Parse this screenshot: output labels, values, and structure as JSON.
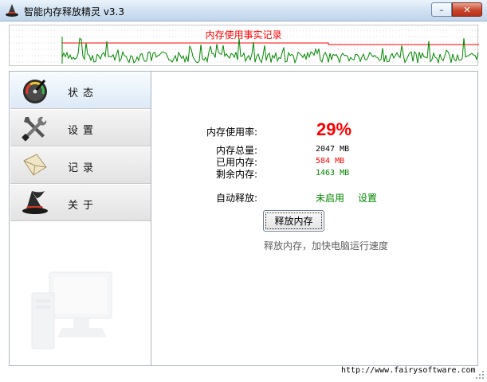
{
  "window": {
    "title": "智能内存释放精灵 v3.3",
    "minimize_label": "–",
    "close_label": "✕",
    "icon": "wizard-hat-icon"
  },
  "graph": {
    "title": "内存使用事实记录",
    "line_color": "#ff0000",
    "trace_color": "#008800"
  },
  "sidebar": {
    "items": [
      {
        "label": "状态",
        "icon": "speedometer-icon",
        "active": true
      },
      {
        "label": "设置",
        "icon": "tools-icon",
        "active": false
      },
      {
        "label": "记录",
        "icon": "envelope-icon",
        "active": false
      },
      {
        "label": "关于",
        "icon": "wizard-hat-icon",
        "active": false
      }
    ]
  },
  "status": {
    "usage_label": "内存使用率:",
    "usage_value": "29%",
    "total_label": "内存总量:",
    "total_value": "2047 MB",
    "used_label": "已用内存:",
    "used_value": "584 MB",
    "free_label": "剩余内存:",
    "free_value": "1463 MB",
    "auto_label": "自动释放:",
    "auto_value": "未启用",
    "settings_link": "设置",
    "release_button": "释放内存",
    "hint": "释放内存，加快电脑运行速度"
  },
  "footer": {
    "url": "http://www.fairysoftware.com"
  },
  "colors": {
    "accent_red": "#ff0000",
    "accent_green": "#008800",
    "titlebar": "#cfe0f1"
  }
}
